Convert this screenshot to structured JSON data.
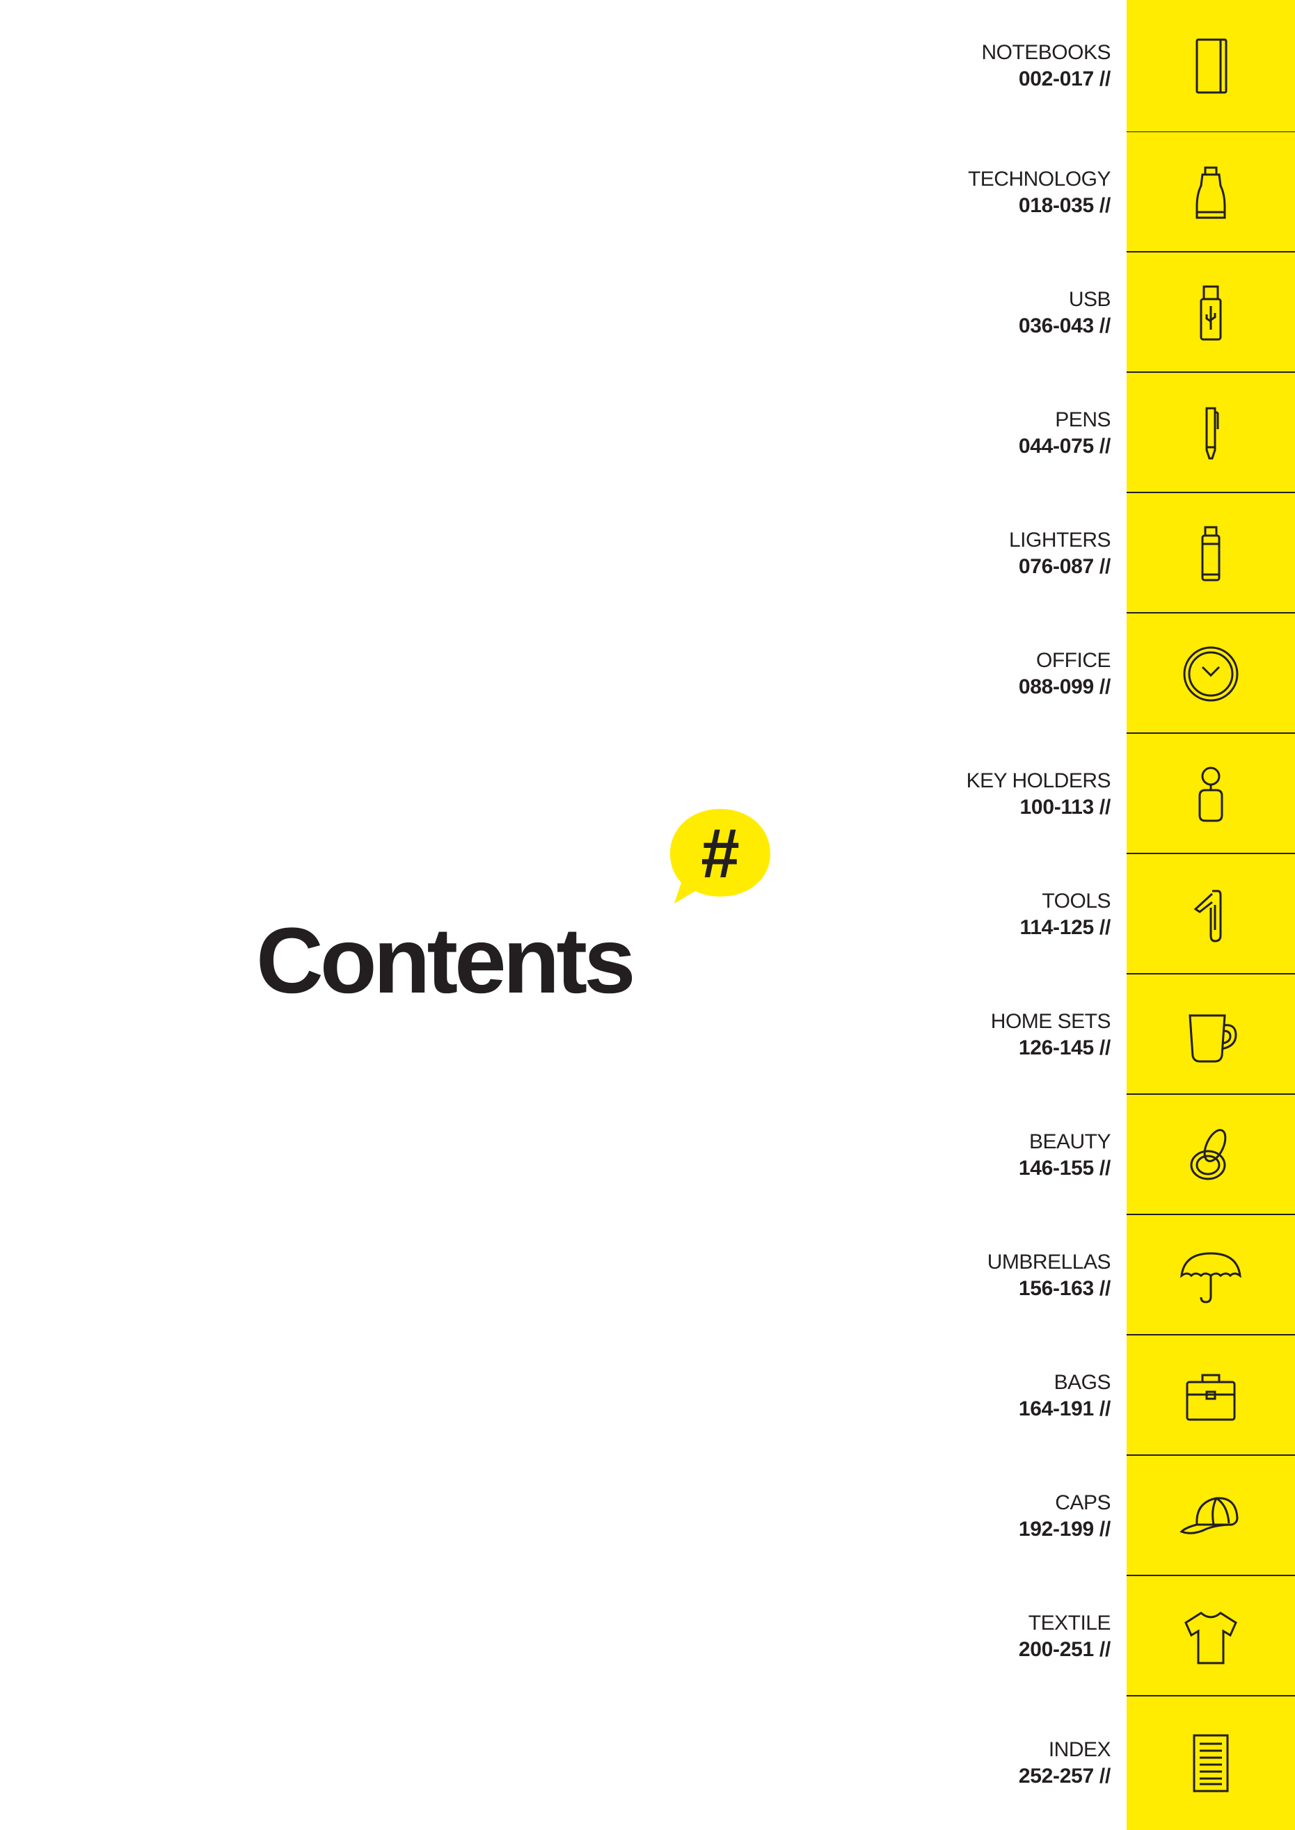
{
  "page": {
    "title": "Contents",
    "badge_symbol": "#",
    "accent_color": "#ffec00",
    "text_color": "#231f20"
  },
  "toc": {
    "items": [
      {
        "label": "NOTEBOOKS",
        "pages": "002-017 //",
        "icon": "notebook-icon"
      },
      {
        "label": "TECHNOLOGY",
        "pages": "018-035 //",
        "icon": "car-charger-icon"
      },
      {
        "label": "USB",
        "pages": "036-043 //",
        "icon": "usb-drive-icon"
      },
      {
        "label": "PENS",
        "pages": "044-075 //",
        "icon": "pen-icon"
      },
      {
        "label": "LIGHTERS",
        "pages": "076-087 //",
        "icon": "lighter-icon"
      },
      {
        "label": "OFFICE",
        "pages": "088-099 //",
        "icon": "clock-icon"
      },
      {
        "label": "KEY HOLDERS",
        "pages": "100-113 //",
        "icon": "keyring-icon"
      },
      {
        "label": "TOOLS",
        "pages": "114-125 //",
        "icon": "pocket-knife-icon"
      },
      {
        "label": "HOME SETS",
        "pages": "126-145 //",
        "icon": "mug-icon"
      },
      {
        "label": "BEAUTY",
        "pages": "146-155 //",
        "icon": "compact-mirror-icon"
      },
      {
        "label": "UMBRELLAS",
        "pages": "156-163 //",
        "icon": "umbrella-icon"
      },
      {
        "label": "BAGS",
        "pages": "164-191 //",
        "icon": "briefcase-icon"
      },
      {
        "label": "CAPS",
        "pages": "192-199 //",
        "icon": "cap-icon"
      },
      {
        "label": "TEXTILE",
        "pages": "200-251 //",
        "icon": "tshirt-icon"
      },
      {
        "label": "INDEX",
        "pages": "252-257 //",
        "icon": "index-document-icon"
      }
    ]
  }
}
